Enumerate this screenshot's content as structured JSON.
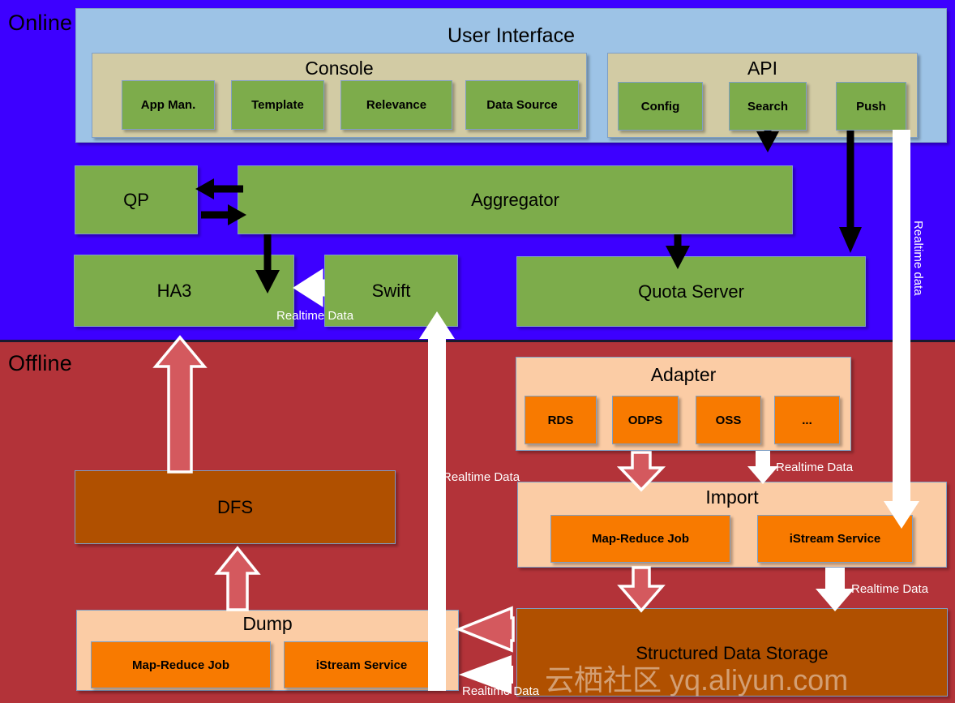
{
  "zones": {
    "online": {
      "label": "Online",
      "color": "#3D00FF"
    },
    "offline": {
      "label": "Offline",
      "color": "#B33339"
    }
  },
  "user_interface": {
    "title": "User Interface",
    "console": {
      "title": "Console",
      "items": [
        {
          "label": "App Man."
        },
        {
          "label": "Template"
        },
        {
          "label": "Relevance"
        },
        {
          "label": "Data Source"
        }
      ]
    },
    "api": {
      "title": "API",
      "items": [
        {
          "label": "Config"
        },
        {
          "label": "Search"
        },
        {
          "label": "Push"
        }
      ]
    }
  },
  "online_services": {
    "qp": "QP",
    "aggregator": "Aggregator",
    "ha3": "HA3",
    "swift": "Swift",
    "quota_server": "Quota Server"
  },
  "offline_services": {
    "dfs": "DFS",
    "adapter": {
      "title": "Adapter",
      "items": [
        {
          "label": "RDS"
        },
        {
          "label": "ODPS"
        },
        {
          "label": "OSS"
        },
        {
          "label": "..."
        }
      ]
    },
    "import": {
      "title": "Import",
      "items": [
        {
          "label": "Map-Reduce Job"
        },
        {
          "label": "iStream Service"
        }
      ]
    },
    "dump": {
      "title": "Dump",
      "items": [
        {
          "label": "Map-Reduce Job"
        },
        {
          "label": "iStream Service"
        }
      ]
    },
    "storage": "Structured Data Storage"
  },
  "flow_labels": {
    "swift_to_ha3": "Realtime Data",
    "push_vertical": "Realtime data",
    "adapter_to_import": "Realtime Data",
    "import_to_storage": "Realtime Data",
    "storage_to_dump": "Realtime Data",
    "dump_to_swift": "Realtime Data"
  },
  "watermark": {
    "text": "云栖社区 yq.aliyun.com"
  },
  "colors": {
    "online_bg": "#3D00FF",
    "offline_bg": "#B33339",
    "ui_panel": "#9DC3E6",
    "group_panel": "#D2CBA4",
    "green": "#7DAC4B",
    "peach": "#FBCCA5",
    "orange": "#F87A00",
    "brown": "#B05000",
    "arrow_white": "#FFFFFF",
    "arrow_red": "#D4595E",
    "arrow_black": "#000000"
  }
}
